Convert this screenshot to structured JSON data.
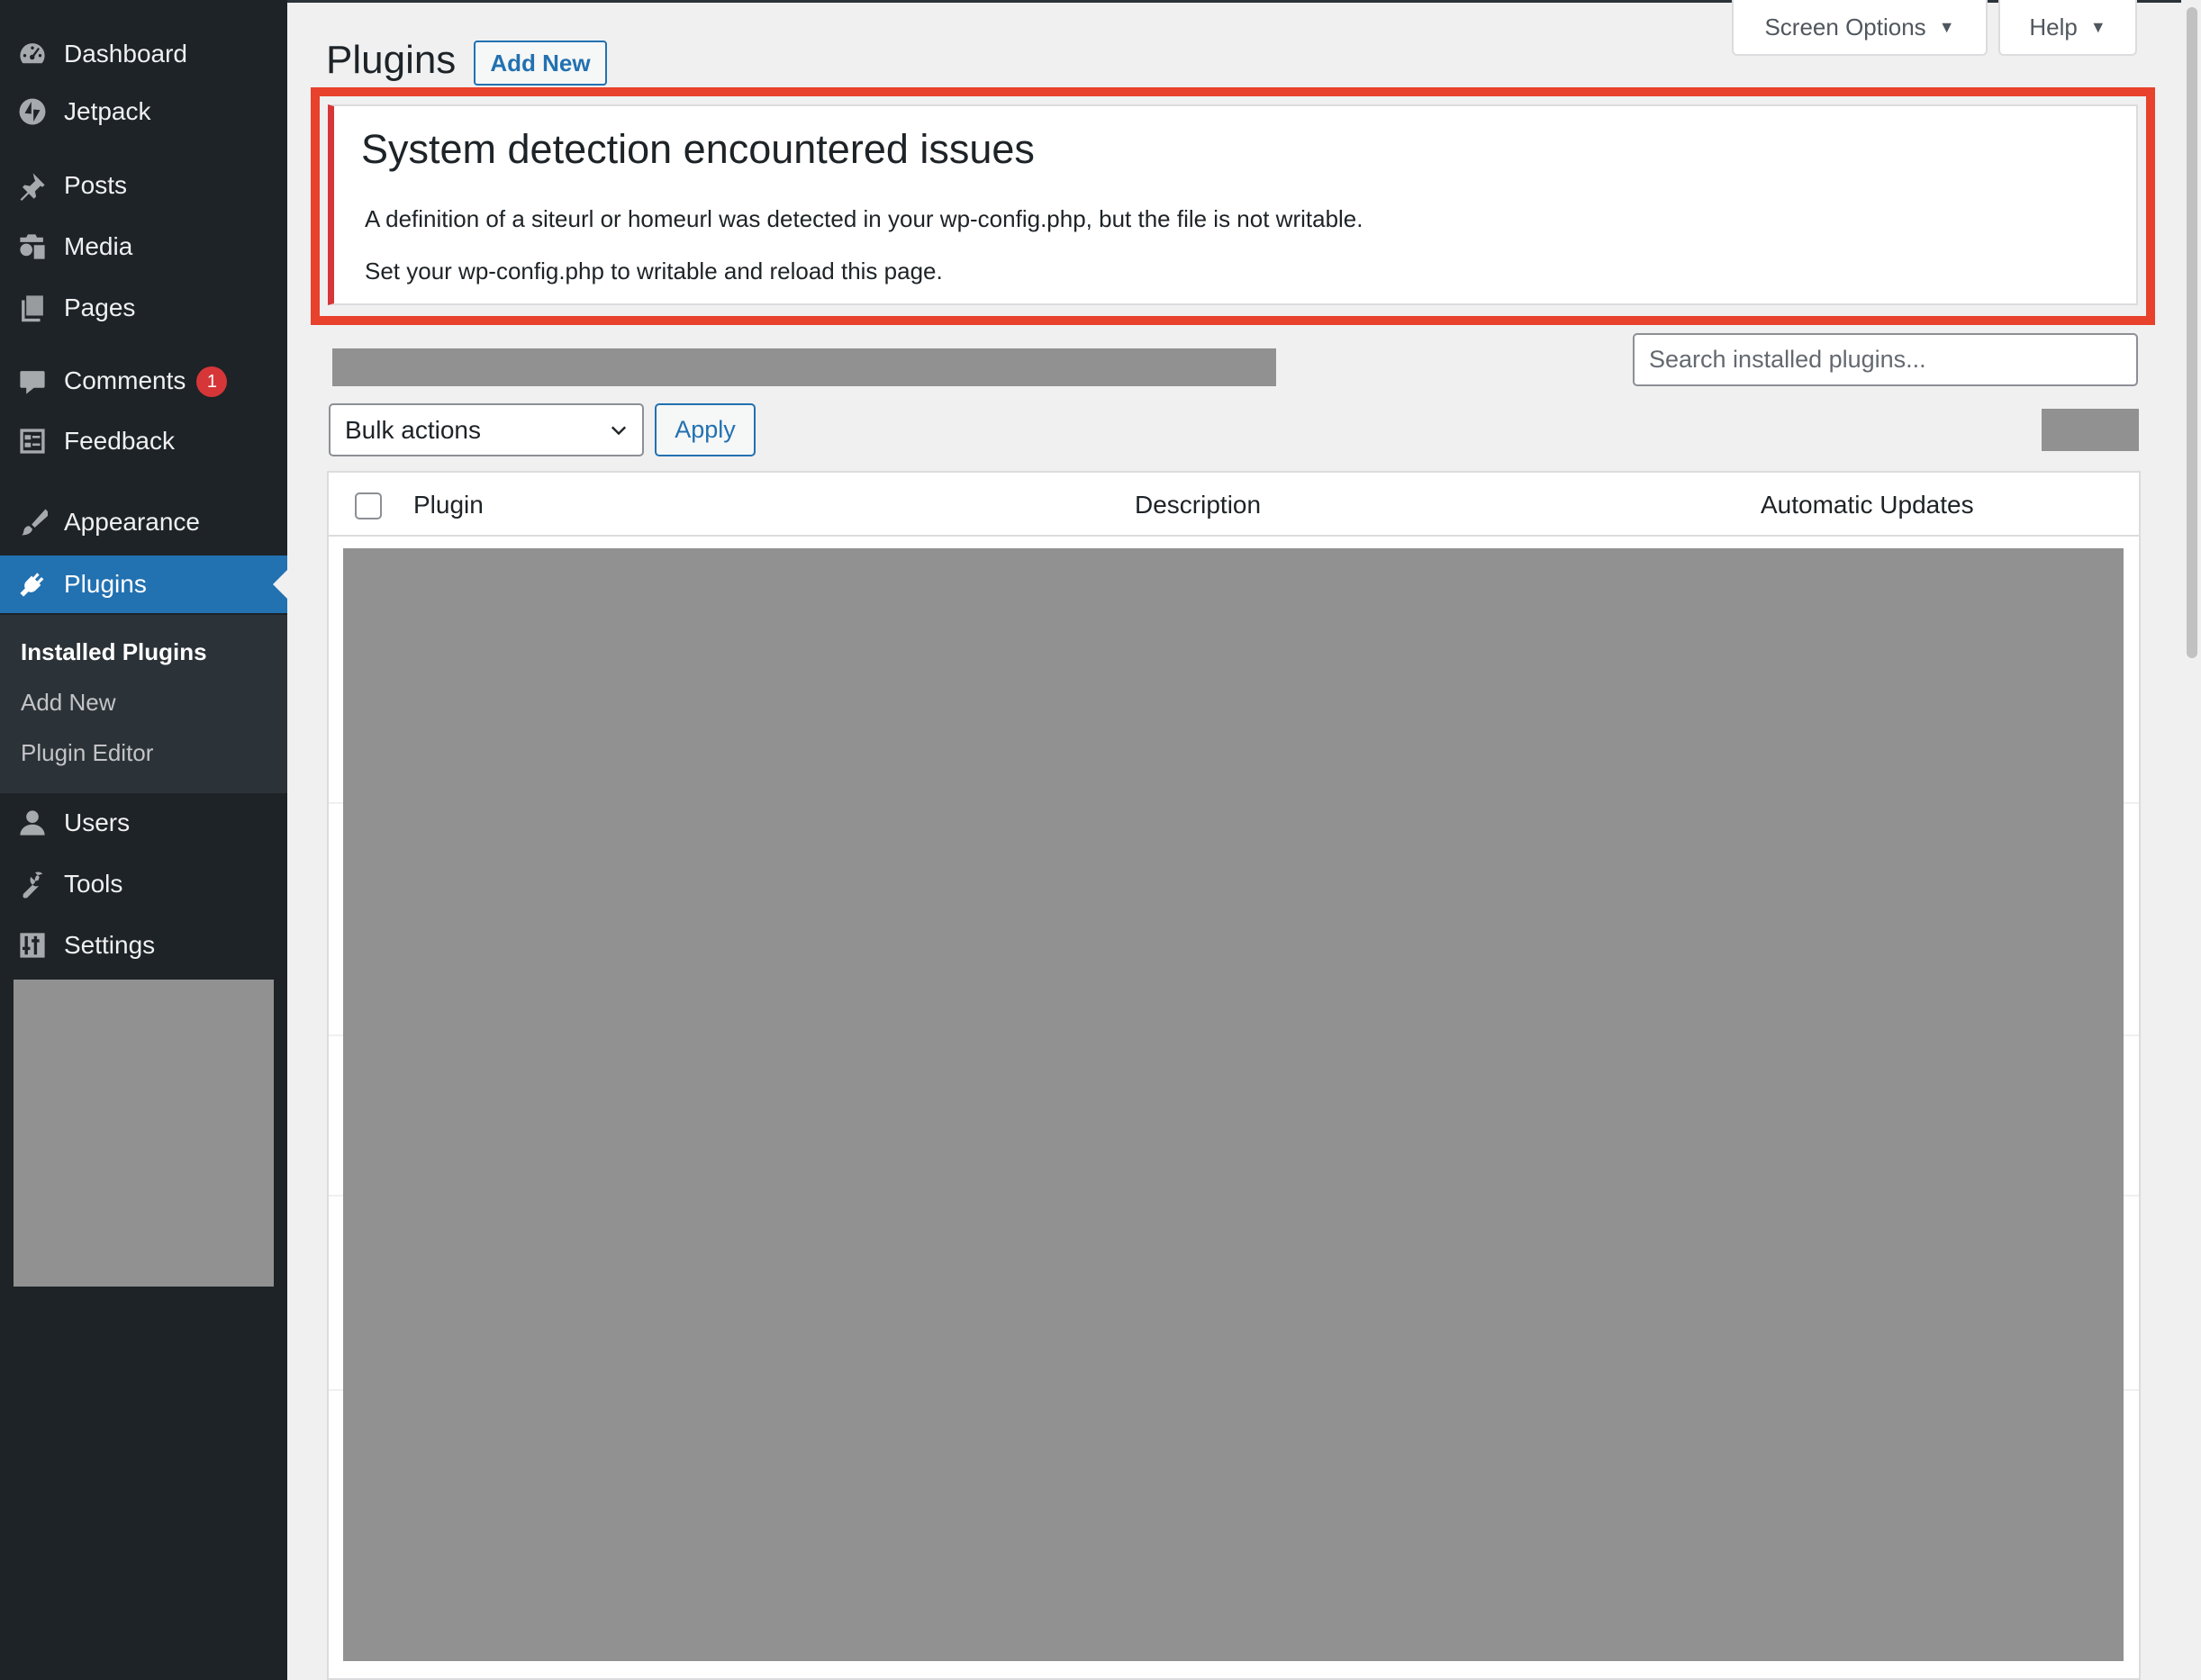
{
  "sidebar": {
    "items": [
      {
        "name": "dashboard",
        "label": "Dashboard",
        "icon": "dashboard-icon"
      },
      {
        "name": "jetpack",
        "label": "Jetpack",
        "icon": "jetpack-icon"
      },
      {
        "name": "posts",
        "label": "Posts",
        "icon": "pin-icon"
      },
      {
        "name": "media",
        "label": "Media",
        "icon": "media-icon"
      },
      {
        "name": "pages",
        "label": "Pages",
        "icon": "pages-icon"
      },
      {
        "name": "comments",
        "label": "Comments",
        "icon": "comment-icon",
        "badge": "1"
      },
      {
        "name": "feedback",
        "label": "Feedback",
        "icon": "feedback-icon"
      },
      {
        "name": "appearance",
        "label": "Appearance",
        "icon": "brush-icon"
      },
      {
        "name": "plugins",
        "label": "Plugins",
        "icon": "plugin-icon",
        "current": true
      },
      {
        "name": "users",
        "label": "Users",
        "icon": "user-icon"
      },
      {
        "name": "tools",
        "label": "Tools",
        "icon": "wrench-icon"
      },
      {
        "name": "settings",
        "label": "Settings",
        "icon": "settings-icon"
      }
    ],
    "submenu": [
      {
        "label": "Installed Plugins",
        "current": true
      },
      {
        "label": "Add New"
      },
      {
        "label": "Plugin Editor"
      }
    ]
  },
  "header": {
    "title": "Plugins",
    "add_new_label": "Add New",
    "screen_options_label": "Screen Options",
    "help_label": "Help"
  },
  "notice": {
    "title": "System detection encountered issues",
    "line1": "A definition of a siteurl or homeurl was detected in your wp-config.php, but the file is not writable.",
    "line2": "Set your wp-config.php to writable and reload this page."
  },
  "search": {
    "placeholder": "Search installed plugins..."
  },
  "bulk_actions": {
    "selected": "Bulk actions",
    "apply_label": "Apply"
  },
  "table": {
    "columns": [
      "Plugin",
      "Description",
      "Automatic Updates"
    ]
  },
  "colors": {
    "sidebar_bg": "#1d2327",
    "accent": "#2271b1",
    "notice_border": "#d63638",
    "highlight": "#e8412c",
    "redacted": "#919191"
  }
}
